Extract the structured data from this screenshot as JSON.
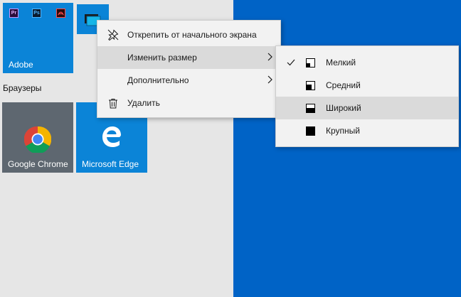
{
  "colors": {
    "desktop": "#0063c6",
    "tile_blue": "#0b84d7",
    "tile_gray": "#5e6770",
    "panel": "#e6e6e6"
  },
  "tiles": {
    "adobe": {
      "label": "Adobe",
      "apps": [
        "Pr",
        "Ps",
        "Acrobat"
      ]
    },
    "chrome": {
      "label": "Google Chrome"
    },
    "edge": {
      "label": "Microsoft Edge"
    }
  },
  "group": {
    "title": "Браузеры"
  },
  "context_menu": {
    "items": [
      {
        "label": "Открепить от начального экрана",
        "icon": "unpin-icon"
      },
      {
        "label": "Изменить размер",
        "icon": null,
        "submenu": true
      },
      {
        "label": "Дополнительно",
        "icon": null,
        "submenu": true
      },
      {
        "label": "Удалить",
        "icon": "trash-icon"
      }
    ]
  },
  "size_menu": {
    "items": [
      {
        "label": "Мелкий",
        "checked": true
      },
      {
        "label": "Средний"
      },
      {
        "label": "Широкий",
        "highlighted": true
      },
      {
        "label": "Крупный"
      }
    ]
  }
}
